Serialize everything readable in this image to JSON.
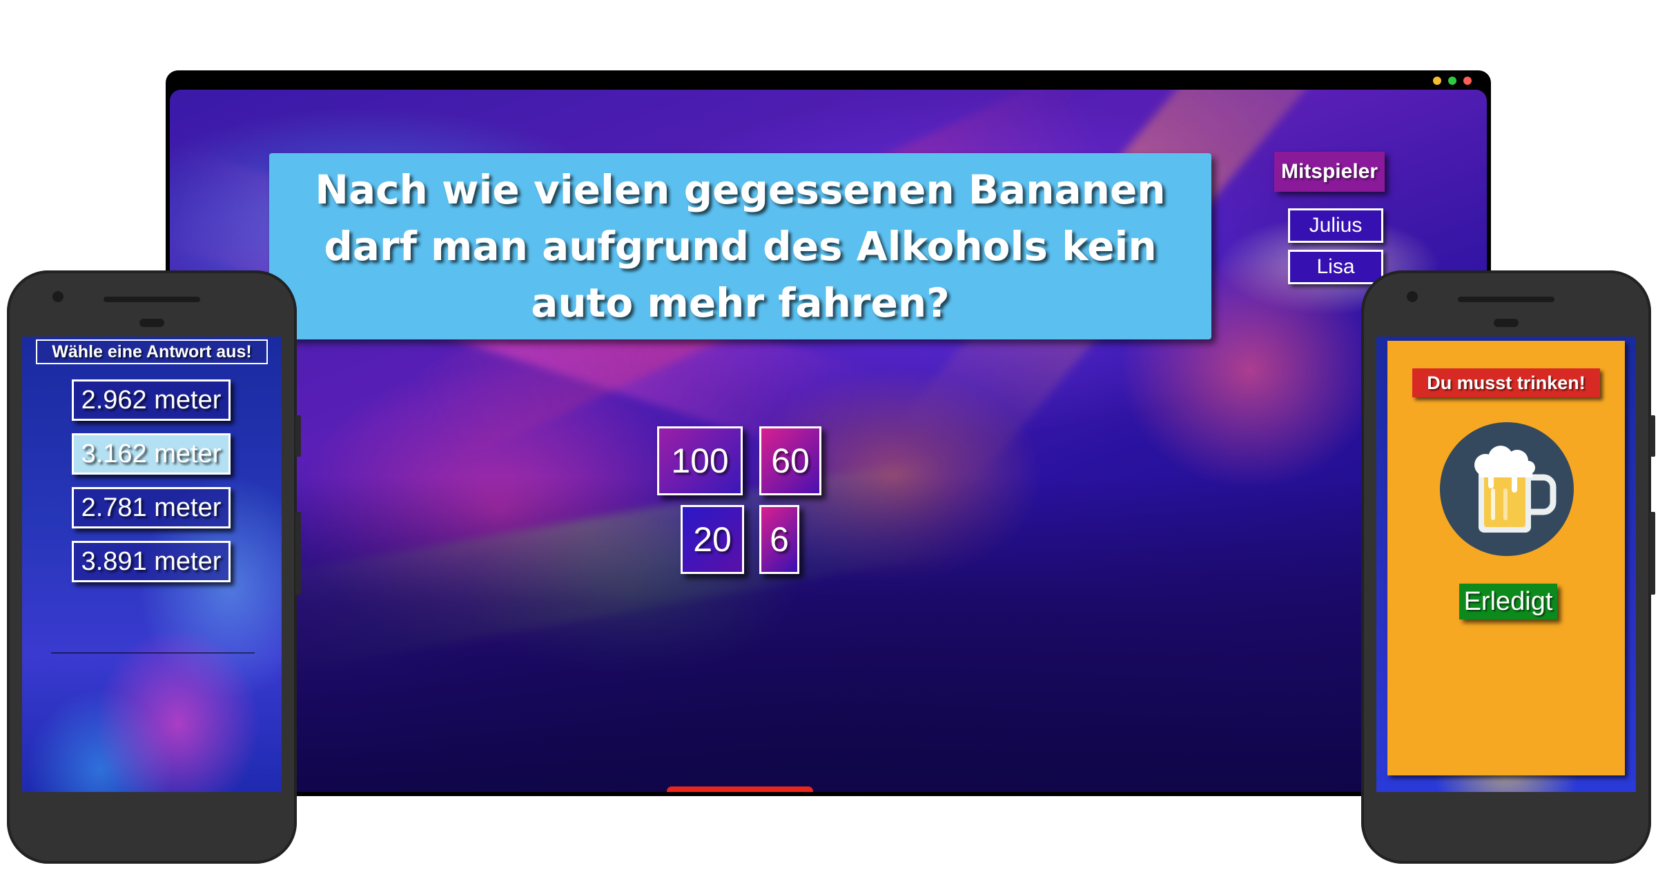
{
  "laptop": {
    "question": "Nach wie vielen gegessenen Bananen darf man aufgrund des Alkohols kein auto mehr fahren?",
    "players_title": "Mitspieler",
    "players": [
      "Julius",
      "Lisa"
    ],
    "answers": [
      "100",
      "60",
      "20",
      "6"
    ],
    "window_dot_colors": [
      "#f5bd2e",
      "#2fca3f",
      "#fc5f57"
    ],
    "progress_bar_color": "#e8261e"
  },
  "left_phone": {
    "prompt": "Wähle eine Antwort aus!",
    "options": [
      "2.962 meter",
      "3.162 meter",
      "2.781 meter",
      "3.891 meter"
    ],
    "selected_option": "3.162 meter"
  },
  "right_phone": {
    "title": "Du musst trinken!",
    "icon": "beer-mug-icon",
    "button_label": "Erledigt"
  },
  "colors": {
    "question_bg": "#5bc0f0",
    "players_title_bg": "#8a1a9a",
    "drink_card_bg": "#f7a823",
    "drink_title_bg": "#d82a24",
    "done_button_bg": "#0c8a1c",
    "beer_circle_bg": "#34495e"
  }
}
